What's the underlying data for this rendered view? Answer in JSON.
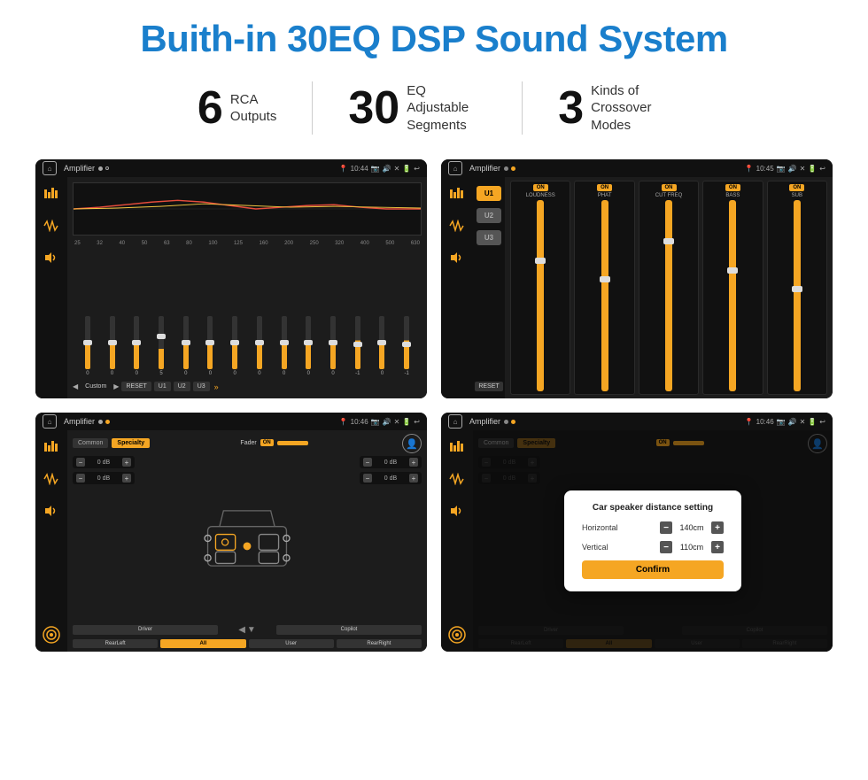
{
  "header": {
    "title": "Buith-in 30EQ DSP Sound System"
  },
  "stats": [
    {
      "number": "6",
      "label": "RCA\nOutputs"
    },
    {
      "number": "30",
      "label": "EQ Adjustable\nSegments"
    },
    {
      "number": "3",
      "label": "Kinds of\nCrossover Modes"
    }
  ],
  "screens": [
    {
      "id": "screen1",
      "title": "Amplifier",
      "time": "10:44",
      "type": "eq",
      "freqs": [
        "25",
        "32",
        "40",
        "50",
        "63",
        "80",
        "100",
        "125",
        "160",
        "200",
        "250",
        "320",
        "400",
        "500",
        "630"
      ],
      "sliders": [
        "0",
        "0",
        "0",
        "5",
        "0",
        "0",
        "0",
        "0",
        "0",
        "0",
        "0",
        "-1",
        "0",
        "-1"
      ],
      "presetLabel": "Custom",
      "buttons": [
        "RESET",
        "U1",
        "U2",
        "U3"
      ]
    },
    {
      "id": "screen2",
      "title": "Amplifier",
      "time": "10:45",
      "type": "amp",
      "presets": [
        "U1",
        "U2",
        "U3"
      ],
      "controls": [
        {
          "label": "LOUDNESS",
          "on": true
        },
        {
          "label": "PHAT",
          "on": true
        },
        {
          "label": "CUT FREQ",
          "on": true
        },
        {
          "label": "BASS",
          "on": true
        },
        {
          "label": "SUB",
          "on": true
        }
      ],
      "resetLabel": "RESET"
    },
    {
      "id": "screen3",
      "title": "Amplifier",
      "time": "10:46",
      "type": "speaker",
      "tabs": [
        "Common",
        "Specialty"
      ],
      "activeTab": "Specialty",
      "faderLabel": "Fader",
      "faderOn": "ON",
      "dbValues": [
        "0 dB",
        "0 dB",
        "0 dB",
        "0 dB"
      ],
      "bottomBtns": [
        "Driver",
        "",
        "All",
        "User",
        "RearRight"
      ],
      "rearLeft": "RearLeft",
      "copilot": "Copilot"
    },
    {
      "id": "screen4",
      "title": "Amplifier",
      "time": "10:46",
      "type": "distance",
      "tabs": [
        "Common",
        "Specialty"
      ],
      "dialog": {
        "title": "Car speaker distance setting",
        "horizontal": {
          "label": "Horizontal",
          "value": "140cm"
        },
        "vertical": {
          "label": "Vertical",
          "value": "110cm"
        },
        "confirmLabel": "Confirm"
      },
      "dbValues": [
        "0 dB",
        "0 dB"
      ],
      "bottomBtns": [
        "Driver",
        "Copilot",
        "RearLeft",
        "All",
        "User",
        "RearRight"
      ]
    }
  ]
}
